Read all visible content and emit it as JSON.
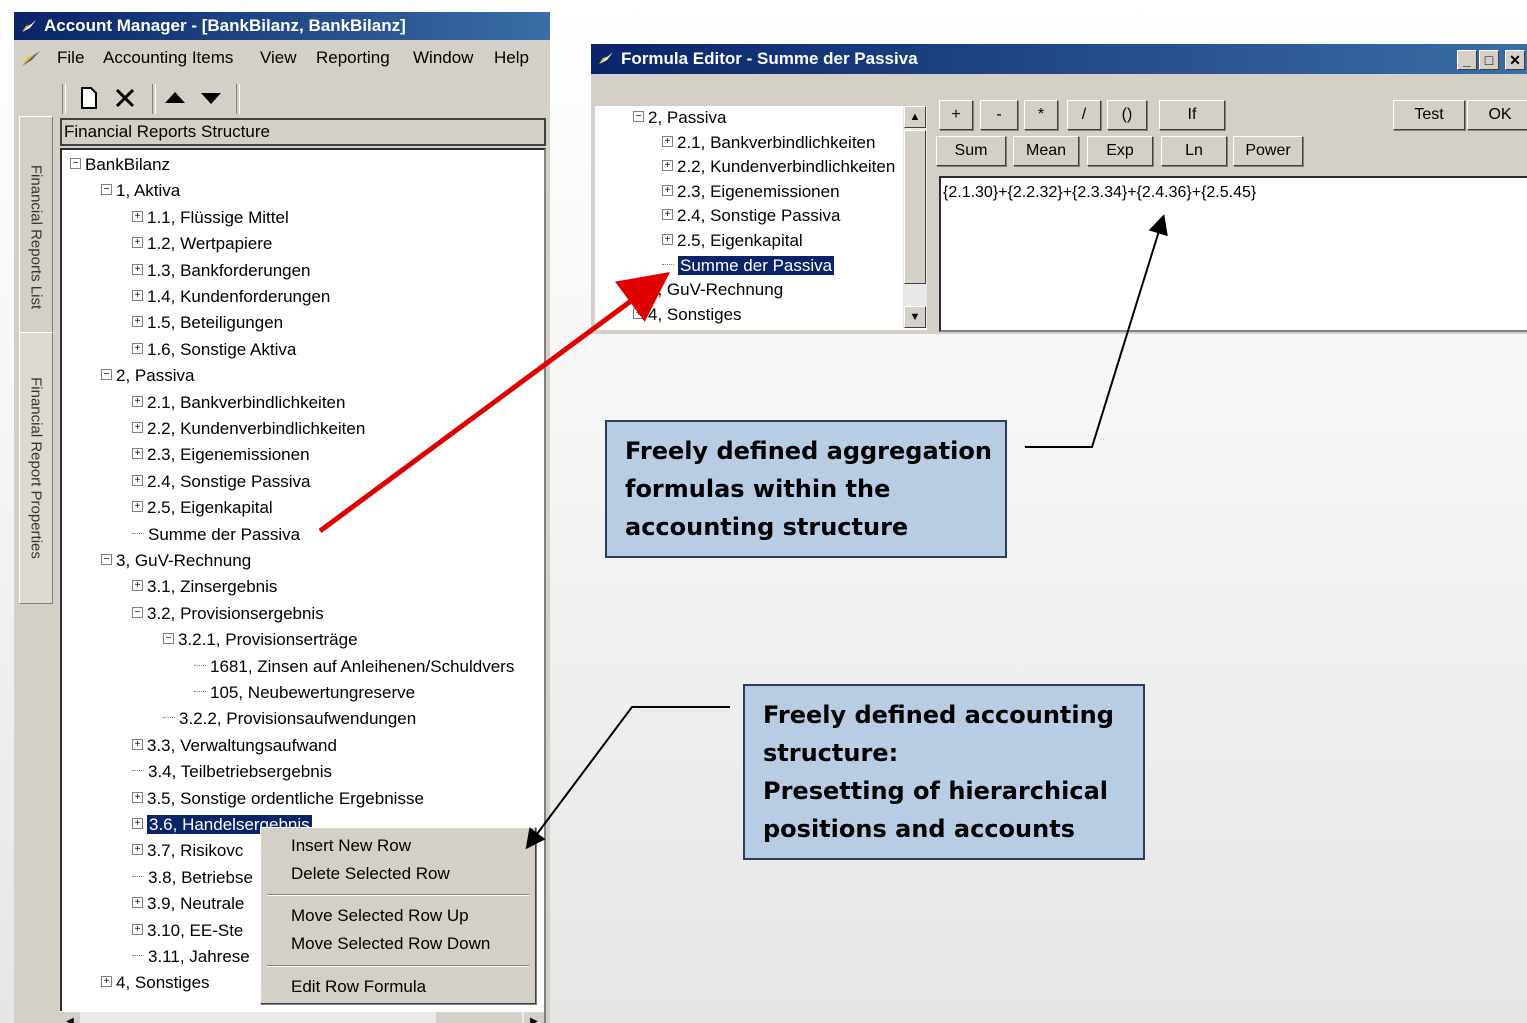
{
  "account_manager": {
    "title": "Account Manager - [BankBilanz, BankBilanz]",
    "menu": [
      "File",
      "Accounting Items",
      "View",
      "Reporting",
      "Window",
      "Help"
    ],
    "side_tabs": [
      "Financial Reports List",
      "Financial Report Properties"
    ],
    "structure_label": "Financial Reports Structure",
    "tree": [
      {
        "label": "BankBilanz",
        "level": 0,
        "icon": "minus-box"
      },
      {
        "label": "1, Aktiva",
        "level": 1,
        "icon": "minus-box"
      },
      {
        "label": "1.1, Flüssige Mittel",
        "level": 2,
        "icon": "plus-box"
      },
      {
        "label": "1.2, Wertpapiere",
        "level": 2,
        "icon": "plus-box"
      },
      {
        "label": "1.3, Bankforderungen",
        "level": 2,
        "icon": "plus-box"
      },
      {
        "label": "1.4, Kundenforderungen",
        "level": 2,
        "icon": "plus-box"
      },
      {
        "label": "1.5, Beteiligungen",
        "level": 2,
        "icon": "plus-box"
      },
      {
        "label": "1.6, Sonstige Aktiva",
        "level": 2,
        "icon": "plus-box"
      },
      {
        "label": "2, Passiva",
        "level": 1,
        "icon": "minus-box"
      },
      {
        "label": "2.1, Bankverbindlichkeiten",
        "level": 2,
        "icon": "plus-box"
      },
      {
        "label": "2.2, Kundenverbindlichkeiten",
        "level": 2,
        "icon": "plus-box"
      },
      {
        "label": "2.3, Eigenemissionen",
        "level": 2,
        "icon": "plus-box"
      },
      {
        "label": "2.4, Sonstige Passiva",
        "level": 2,
        "icon": "plus-box"
      },
      {
        "label": "2.5, Eigenkapital",
        "level": 2,
        "icon": "plus-box"
      },
      {
        "label": "Summe der Passiva",
        "level": 2,
        "icon": "leaf"
      },
      {
        "label": "3, GuV-Rechnung",
        "level": 1,
        "icon": "minus-box"
      },
      {
        "label": "3.1, Zinsergebnis",
        "level": 2,
        "icon": "plus-box"
      },
      {
        "label": "3.2, Provisionsergebnis",
        "level": 2,
        "icon": "minus-box"
      },
      {
        "label": "3.2.1, Provisionserträge",
        "level": 3,
        "icon": "minus-box"
      },
      {
        "label": "1681, Zinsen auf Anleihenen/Schuldvers",
        "level": 4,
        "icon": "leaf"
      },
      {
        "label": "105, Neubewertungreserve",
        "level": 4,
        "icon": "leaf"
      },
      {
        "label": "3.2.2, Provisionsaufwendungen",
        "level": 3,
        "icon": "leaf"
      },
      {
        "label": "3.3, Verwaltungsaufwand",
        "level": 2,
        "icon": "plus-box"
      },
      {
        "label": "3.4, Teilbetriebsergebnis",
        "level": 2,
        "icon": "leaf"
      },
      {
        "label": "3.5, Sonstige ordentliche Ergebnisse",
        "level": 2,
        "icon": "plus-box"
      },
      {
        "label": "3.6, Handelsergebnis",
        "level": 2,
        "icon": "plus-box",
        "selected": true
      },
      {
        "label": "3.7, Risikovc",
        "level": 2,
        "icon": "plus-box"
      },
      {
        "label": "3.8, Betriebse",
        "level": 2,
        "icon": "leaf"
      },
      {
        "label": "3.9, Neutrale",
        "level": 2,
        "icon": "plus-box"
      },
      {
        "label": "3.10, EE-Ste",
        "level": 2,
        "icon": "plus-box"
      },
      {
        "label": "3.11, Jahrese",
        "level": 2,
        "icon": "leaf"
      },
      {
        "label": "4, Sonstiges",
        "level": 1,
        "icon": "plus-box"
      }
    ],
    "context_menu": [
      "Insert New Row",
      "Delete Selected Row",
      "Move Selected Row Up",
      "Move Selected Row Down",
      "Edit Row Formula"
    ]
  },
  "formula_editor": {
    "title": "Formula Editor - Summe der Passiva",
    "tree": [
      {
        "label": "2, Passiva",
        "level": 0,
        "icon": "minus-box"
      },
      {
        "label": "2.1, Bankverbindlichkeiten",
        "level": 1,
        "icon": "plus-box"
      },
      {
        "label": "2.2, Kundenverbindlichkeiten",
        "level": 1,
        "icon": "plus-box"
      },
      {
        "label": "2.3, Eigenemissionen",
        "level": 1,
        "icon": "plus-box"
      },
      {
        "label": "2.4, Sonstige Passiva",
        "level": 1,
        "icon": "plus-box"
      },
      {
        "label": "2.5, Eigenkapital",
        "level": 1,
        "icon": "plus-box"
      },
      {
        "label": "Summe der Passiva",
        "level": 1,
        "icon": "leaf",
        "selected": true
      },
      {
        "label": "3, GuV-Rechnung",
        "level": 0,
        "icon": "plus-box"
      },
      {
        "label": "4, Sonstiges",
        "level": 0,
        "icon": "plus-box"
      }
    ],
    "operator_buttons": [
      "+",
      "-",
      "*",
      "/",
      "()",
      "If"
    ],
    "function_buttons": [
      "Sum",
      "Mean",
      "Exp",
      "Ln",
      "Power"
    ],
    "action_buttons": [
      "Test",
      "OK"
    ],
    "formula": "{2.1.30}+{2.2.32}+{2.3.34}+{2.4.36}+{2.5.45}"
  },
  "callouts": {
    "aggregation": [
      "Freely defined aggregation",
      "formulas within the",
      "accounting structure"
    ],
    "structure": [
      "Freely defined accounting",
      "structure:",
      "Presetting of hierarchical",
      "positions and accounts"
    ]
  },
  "colors": {
    "title_bar": "#0a246a",
    "selection": "#0a246a",
    "callout_fill": "#b8cce4",
    "arrow_red": "#e00000"
  }
}
